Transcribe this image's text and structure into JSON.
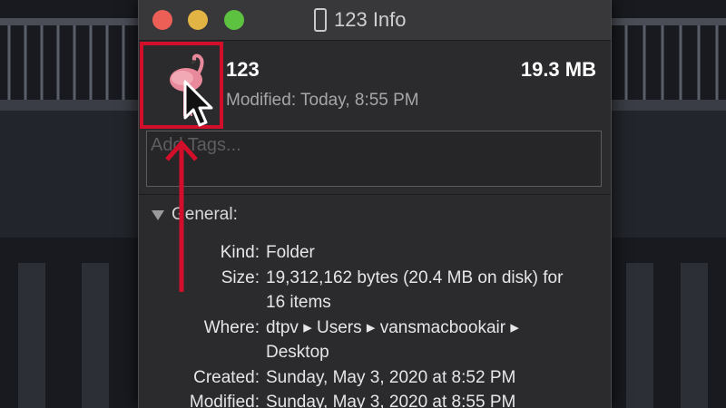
{
  "window": {
    "title": "123 Info"
  },
  "file": {
    "name": "123",
    "size": "19.3 MB",
    "modified": "Modified: Today, 8:55 PM",
    "icon": "flamingo-folder-icon"
  },
  "tags": {
    "placeholder": "Add Tags..."
  },
  "general": {
    "header": "General:",
    "rows": [
      {
        "label": "Kind:",
        "value": "Folder"
      },
      {
        "label": "Size:",
        "value": "19,312,162 bytes (20.4 MB on disk) for 16 items"
      },
      {
        "label": "Where:",
        "value": "dtpv ▸ Users ▸ vansmacbookair ▸ Desktop"
      },
      {
        "label": "Created:",
        "value": "Sunday, May 3, 2020 at 8:52 PM"
      },
      {
        "label": "Modified:",
        "value": "Sunday, May 3, 2020 at 8:55 PM"
      }
    ]
  },
  "annotation": {
    "color": "#d10f2a"
  }
}
